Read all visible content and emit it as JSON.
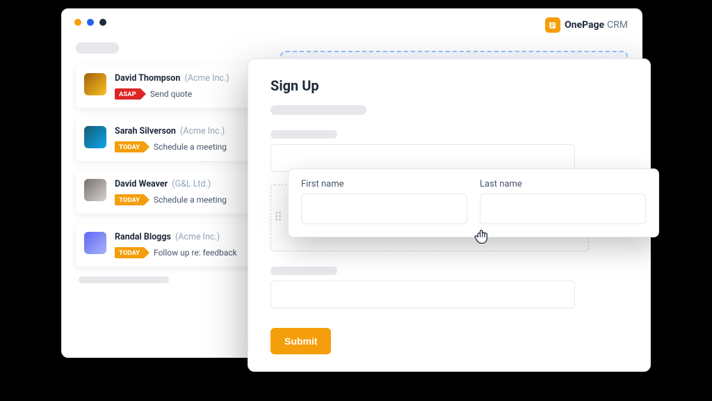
{
  "brand": {
    "name": "OnePage",
    "suffix": "CRM"
  },
  "sidebar": {
    "items": [
      {
        "name": "David Thompson",
        "company": "(Acme Inc.)",
        "flag": "ASAP",
        "flag_type": "asap",
        "action": "Send quote"
      },
      {
        "name": "Sarah Silverson",
        "company": "(Acme Inc.)",
        "flag": "TODAY",
        "flag_type": "today",
        "action": "Schedule a meeting"
      },
      {
        "name": "David Weaver",
        "company": "(G&L Ltd.)",
        "flag": "TODAY",
        "flag_type": "today",
        "action": "Schedule a meeting"
      },
      {
        "name": "Randal Bloggs",
        "company": "(Acme Inc.)",
        "flag": "TODAY",
        "flag_type": "today",
        "action": "Follow up re: feedback"
      }
    ]
  },
  "signup": {
    "title": "Sign Up",
    "first_name_label": "First name",
    "last_name_label": "Last name",
    "submit_label": "Submit"
  }
}
